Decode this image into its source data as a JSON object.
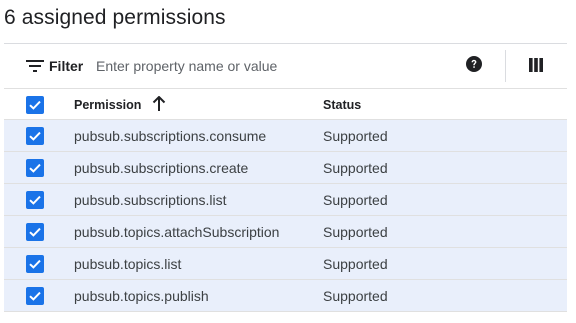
{
  "page": {
    "title": "6 assigned permissions"
  },
  "filter": {
    "label": "Filter",
    "placeholder": "Enter property name or value",
    "value": "",
    "help_icon": "help-circle-icon",
    "columns_icon": "view-columns-icon",
    "filter_icon": "filter-list-icon"
  },
  "table": {
    "headers": {
      "permission": "Permission",
      "status": "Status"
    },
    "sort": {
      "column": "Permission",
      "direction": "ascending",
      "icon": "arrow-up-icon"
    },
    "header_checked": true,
    "rows": [
      {
        "permission": "pubsub.subscriptions.consume",
        "status": "Supported",
        "checked": true
      },
      {
        "permission": "pubsub.subscriptions.create",
        "status": "Supported",
        "checked": true
      },
      {
        "permission": "pubsub.subscriptions.list",
        "status": "Supported",
        "checked": true
      },
      {
        "permission": "pubsub.topics.attachSubscription",
        "status": "Supported",
        "checked": true
      },
      {
        "permission": "pubsub.topics.list",
        "status": "Supported",
        "checked": true
      },
      {
        "permission": "pubsub.topics.publish",
        "status": "Supported",
        "checked": true
      }
    ]
  },
  "colors": {
    "accent": "#1a73e8",
    "row_selected_bg": "#e9effb",
    "border": "#dadce0"
  }
}
